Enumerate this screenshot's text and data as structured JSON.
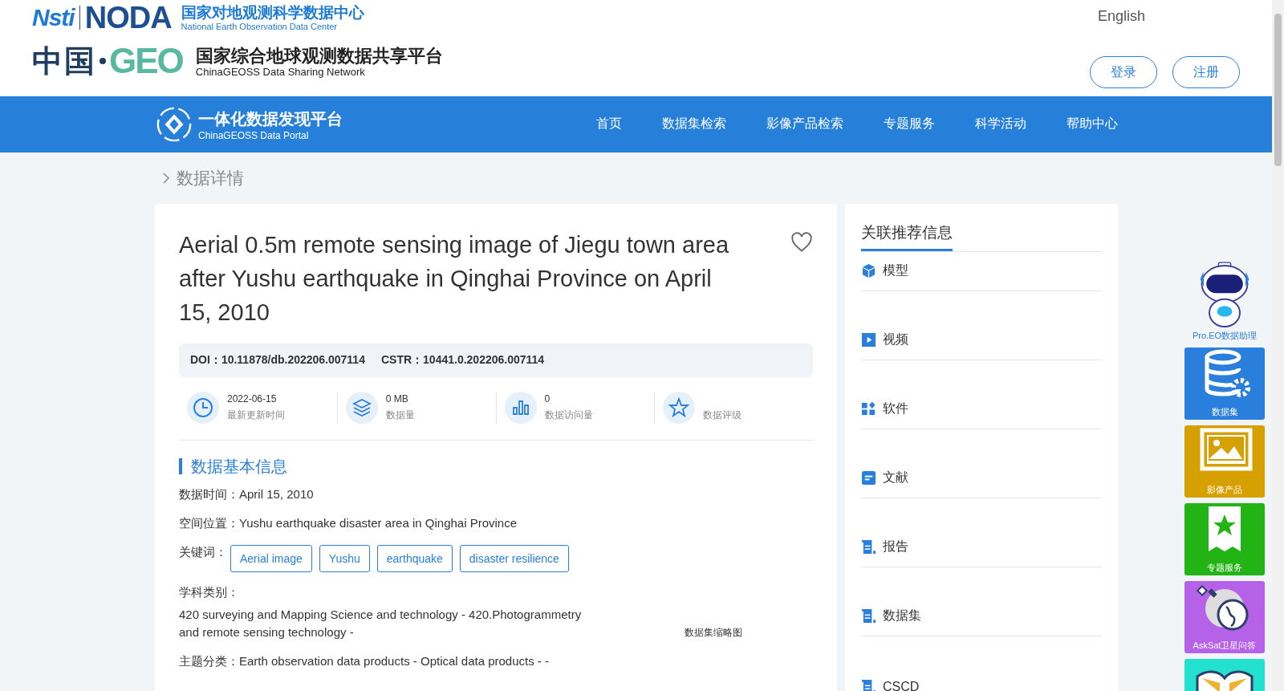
{
  "header": {
    "noda_logo": {
      "mark_left": "Nsti",
      "mark_right": "NODA",
      "title": "国家对地观测科学数据中心",
      "subtitle": "National Earth Observation Data Center"
    },
    "geo_logo": {
      "mark_left": "中国",
      "mark_right": "GEO",
      "title": "国家综合地球观测数据共享平台",
      "subtitle": "ChinaGEOSS Data Sharing Network"
    },
    "language": "English",
    "buttons": [
      "登录",
      "注册"
    ]
  },
  "nav": {
    "logo_title": "一体化数据发现平台",
    "logo_subtitle": "ChinaGEOSS Data Portal",
    "items": [
      {
        "label": "首页",
        "selected": false
      },
      {
        "label": "数据集检索",
        "selected": false
      },
      {
        "label": "影像产品检索",
        "selected": false
      },
      {
        "label": "专题服务",
        "selected": false
      },
      {
        "label": "科学活动",
        "selected": false
      },
      {
        "label": "帮助中心",
        "selected": false
      }
    ]
  },
  "breadcrumb": "数据详情",
  "dataset": {
    "title": "Aerial 0.5m remote sensing image of Jiegu town area after Yushu earthquake in Qinghai Province on April 15, 2010",
    "favorite": false,
    "doi": {
      "label": "DOI：",
      "value": "10.11878/db.202206.007114"
    },
    "cstr": {
      "label": "CSTR：",
      "value": "10441.0.202206.007114"
    },
    "stats": [
      {
        "value": "2022-06-15",
        "label": "最新更新时间"
      },
      {
        "value": "0 MB",
        "label": "数据量"
      },
      {
        "value": "0",
        "label": "数据访问量"
      },
      {
        "label": "数据评级"
      }
    ],
    "basic_info": {
      "heading": "数据基本信息",
      "fields": [
        {
          "kind": "inline",
          "label": "数据时间：",
          "value": "April 15, 2010"
        },
        {
          "kind": "inline",
          "label": "空间位置：",
          "value": "Yushu earthquake disaster area in Qinghai Province"
        },
        {
          "kind": "tags",
          "label": "关键词：",
          "tags": [
            "Aerial image",
            "Yushu",
            "earthquake",
            "disaster resilience"
          ]
        },
        {
          "kind": "block",
          "label": "学科类别：",
          "value": "420 surveying and Mapping Science and technology - 420.Photogrammetry and remote sensing technology -"
        },
        {
          "kind": "inline",
          "label": "主题分类：",
          "value": "Earth observation data products - Optical data products - -"
        }
      ],
      "thumbnail_caption": "数据集缩略图"
    }
  },
  "related": {
    "title": "关联推荐信息",
    "items": [
      "模型",
      "视频",
      "软件",
      "文献",
      "报告",
      "数据集",
      "CSCD"
    ]
  },
  "dock": {
    "assistant": "Pro.EO数据助理",
    "tiles": [
      {
        "label": "数据集",
        "color": "#2a7fdc"
      },
      {
        "label": "影像产品",
        "color": "#d6a000"
      },
      {
        "label": "专题服务",
        "color": "#22b414"
      },
      {
        "label": "AskSat卫星问答",
        "color": "#b562e8"
      },
      {
        "color": "#22e2cf"
      }
    ]
  }
}
